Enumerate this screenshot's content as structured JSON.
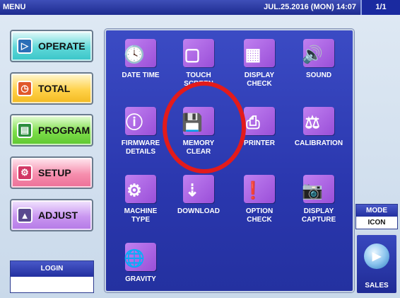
{
  "topbar": {
    "title": "MENU",
    "datetime": "JUL.25.2016 (MON) 14:07",
    "page": "1/1"
  },
  "sidebar": {
    "buttons": [
      {
        "label": "OPERATE",
        "icon": "play-circle-icon"
      },
      {
        "label": "TOTAL",
        "icon": "clock-icon"
      },
      {
        "label": "PROGRAM",
        "icon": "book-icon"
      },
      {
        "label": "SETUP",
        "icon": "wrench-icon"
      },
      {
        "label": "ADJUST",
        "icon": "scale-icon"
      }
    ],
    "login": {
      "label": "LOGIN",
      "value": ""
    }
  },
  "menu": {
    "items": [
      {
        "line1": "DATE TIME",
        "line2": "",
        "icon": "calendar-clock-icon"
      },
      {
        "line1": "TOUCH",
        "line2": "SCREEN",
        "icon": "touch-screen-icon"
      },
      {
        "line1": "DISPLAY",
        "line2": "CHECK",
        "icon": "display-check-icon"
      },
      {
        "line1": "SOUND",
        "line2": "",
        "icon": "speaker-icon"
      },
      {
        "line1": "FIRMWARE",
        "line2": "DETAILS",
        "icon": "info-icon"
      },
      {
        "line1": "MEMORY",
        "line2": "CLEAR",
        "icon": "memory-clear-icon"
      },
      {
        "line1": "PRINTER",
        "line2": "",
        "icon": "printer-icon"
      },
      {
        "line1": "CALIBRATION",
        "line2": "",
        "icon": "calibration-icon"
      },
      {
        "line1": "MACHINE",
        "line2": "TYPE",
        "icon": "gears-icon"
      },
      {
        "line1": "DOWNLOAD",
        "line2": "",
        "icon": "download-folder-icon"
      },
      {
        "line1": "OPTION",
        "line2": "CHECK",
        "icon": "option-check-icon"
      },
      {
        "line1": "DISPLAY",
        "line2": "CAPTURE",
        "icon": "camera-icon"
      },
      {
        "line1": "GRAVITY",
        "line2": "",
        "icon": "globe-scale-icon"
      }
    ]
  },
  "mode": {
    "label": "MODE",
    "value": "ICON"
  },
  "sales": {
    "label": "SALES",
    "icon": "play-icon"
  },
  "colors": {
    "accent": "#2a37ae",
    "highlight_circle": "#e31b1b"
  }
}
